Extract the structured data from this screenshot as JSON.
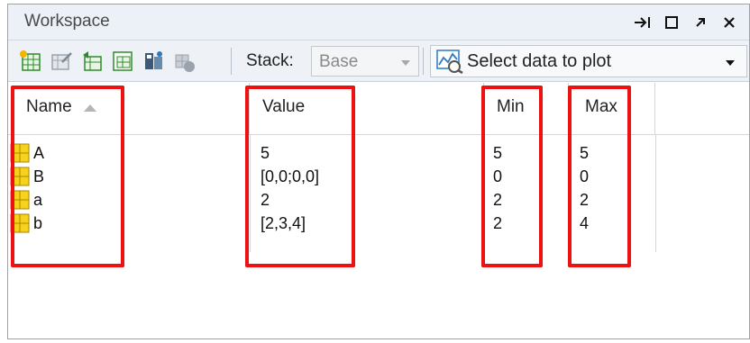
{
  "window": {
    "title": "Workspace"
  },
  "toolbar": {
    "stack_label": "Stack:",
    "stack_value": "Base",
    "plot_label": "Select data to plot"
  },
  "columns": {
    "name": "Name",
    "value": "Value",
    "min": "Min",
    "max": "Max"
  },
  "rows": [
    {
      "name": "A",
      "value": "5",
      "min": "5",
      "max": "5"
    },
    {
      "name": "B",
      "value": "[0,0;0,0]",
      "min": "0",
      "max": "0"
    },
    {
      "name": "a",
      "value": "2",
      "min": "2",
      "max": "2"
    },
    {
      "name": "b",
      "value": "[2,3,4]",
      "min": "2",
      "max": "4"
    }
  ],
  "colors": {
    "highlight": "#ee1111",
    "variable_icon": "#f2c200"
  },
  "icons": [
    "new-variable-icon",
    "open-variable-icon",
    "load-data-icon",
    "save-workspace-icon",
    "print-icon",
    "delete-icon",
    "plot-icon",
    "undock-icon",
    "maximize-icon",
    "minimize-icon",
    "close-icon",
    "matrix-variable-icon"
  ]
}
